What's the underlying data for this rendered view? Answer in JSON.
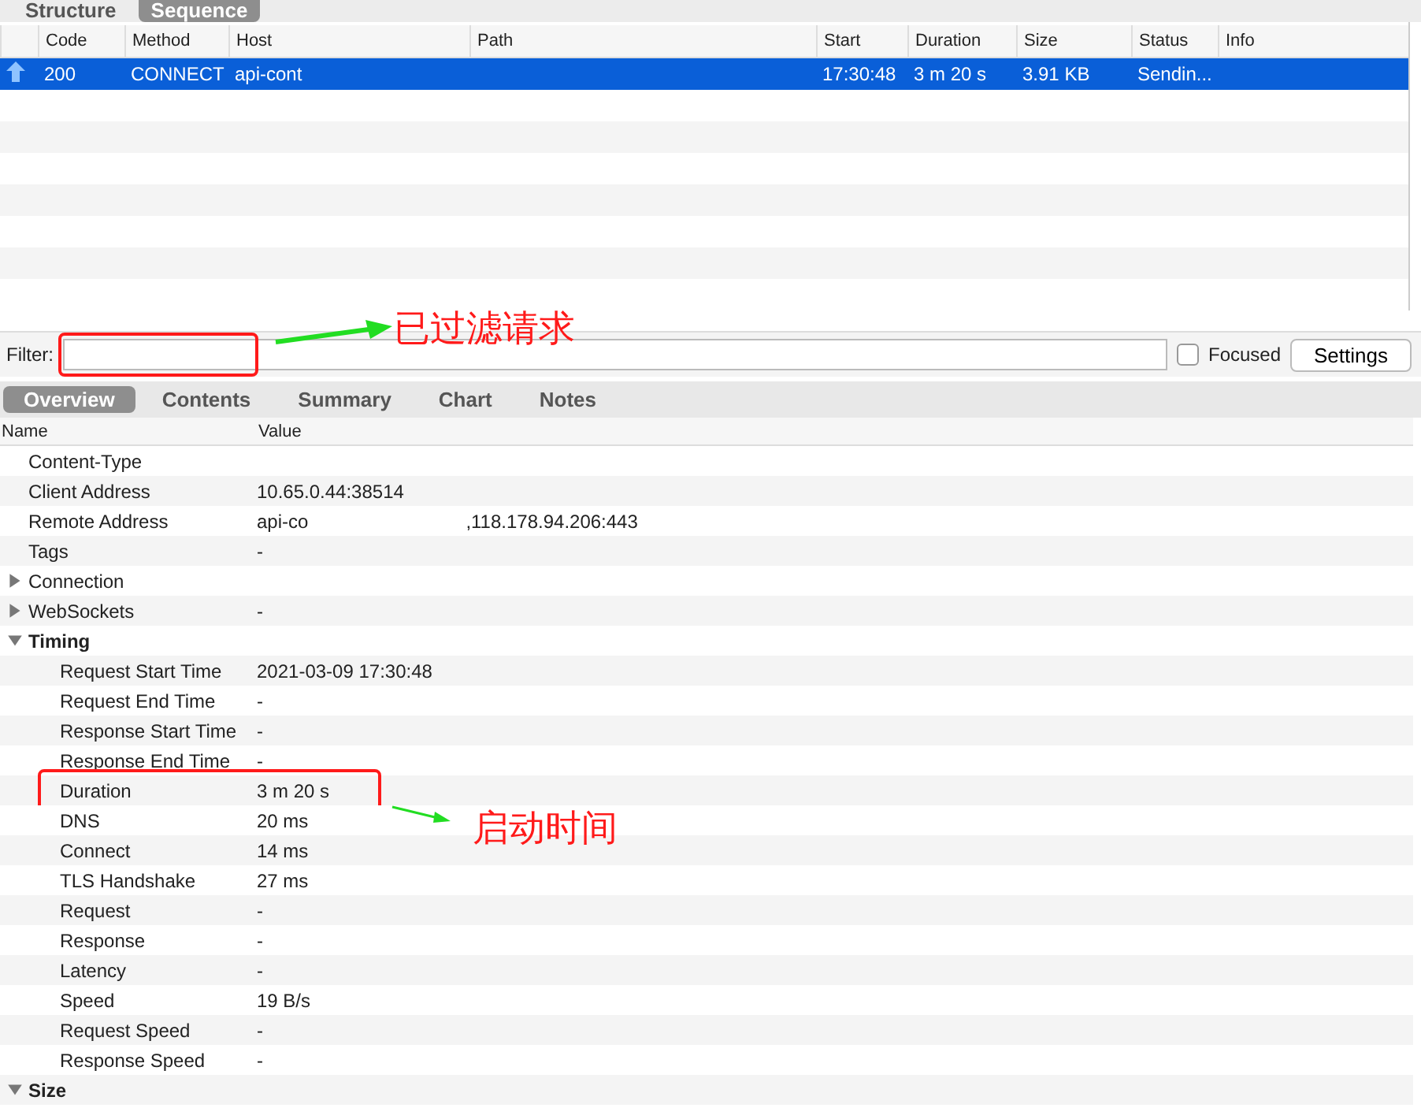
{
  "view_tabs": [
    {
      "label": "Structure",
      "selected": false
    },
    {
      "label": "Sequence",
      "selected": true
    }
  ],
  "requests": {
    "columns": [
      "Code",
      "Method",
      "Host",
      "Path",
      "Start",
      "Duration",
      "Size",
      "Status",
      "Info"
    ],
    "rows": [
      {
        "selected": true,
        "cells": [
          "200",
          "CONNECT",
          "api-cont",
          "",
          "17:30:48",
          "3 m 20 s",
          "3.91 KB",
          "Sendin...",
          ""
        ]
      }
    ]
  },
  "filter": {
    "label": "Filter:",
    "highlighted": true,
    "focused_label": "Focused",
    "focused_checked": false,
    "settings_button": "Settings"
  },
  "detail_tabs": [
    {
      "label": "Overview",
      "selected": true
    },
    {
      "label": "Contents",
      "selected": false
    },
    {
      "label": "Summary",
      "selected": false
    },
    {
      "label": "Chart",
      "selected": false
    },
    {
      "label": "Notes",
      "selected": false
    }
  ],
  "overview": {
    "columns": [
      "Name",
      "Value"
    ],
    "rows": [
      {
        "name": "Content-Type",
        "value": ""
      },
      {
        "name": "Client Address",
        "value": "10.65.0.44:38514"
      },
      {
        "name": "Remote Address",
        "value": "api-co",
        "value_after": ",118.178.94.206:443"
      },
      {
        "name": "Tags",
        "value": "-"
      },
      {
        "name": "Connection",
        "value": "",
        "kind": "group",
        "expanded": false,
        "children": []
      },
      {
        "name": "WebSockets",
        "value": "-",
        "kind": "group",
        "expanded": false,
        "children": []
      },
      {
        "name": "Timing",
        "value": "",
        "kind": "section",
        "expanded": true,
        "children": [
          {
            "name": "Request Start Time",
            "value": "2021-03-09 17:30:48"
          },
          {
            "name": "Request End Time",
            "value": "-"
          },
          {
            "name": "Response Start Time",
            "value": "-"
          },
          {
            "name": "Response End Time",
            "value": "-"
          },
          {
            "name": "Duration",
            "value": "3 m 20 s",
            "highlighted": true
          },
          {
            "name": "DNS",
            "value": "20 ms"
          },
          {
            "name": "Connect",
            "value": "14 ms"
          },
          {
            "name": "TLS Handshake",
            "value": "27 ms"
          },
          {
            "name": "Request",
            "value": "-"
          },
          {
            "name": "Response",
            "value": "-"
          },
          {
            "name": "Latency",
            "value": "-"
          },
          {
            "name": "Speed",
            "value": "19 B/s"
          },
          {
            "name": "Request Speed",
            "value": "-"
          },
          {
            "name": "Response Speed",
            "value": "-"
          }
        ]
      },
      {
        "name": "Size",
        "value": "",
        "kind": "section",
        "expanded": true,
        "children": []
      }
    ]
  },
  "annotations": [
    "已过滤请求",
    "启动时间"
  ]
}
